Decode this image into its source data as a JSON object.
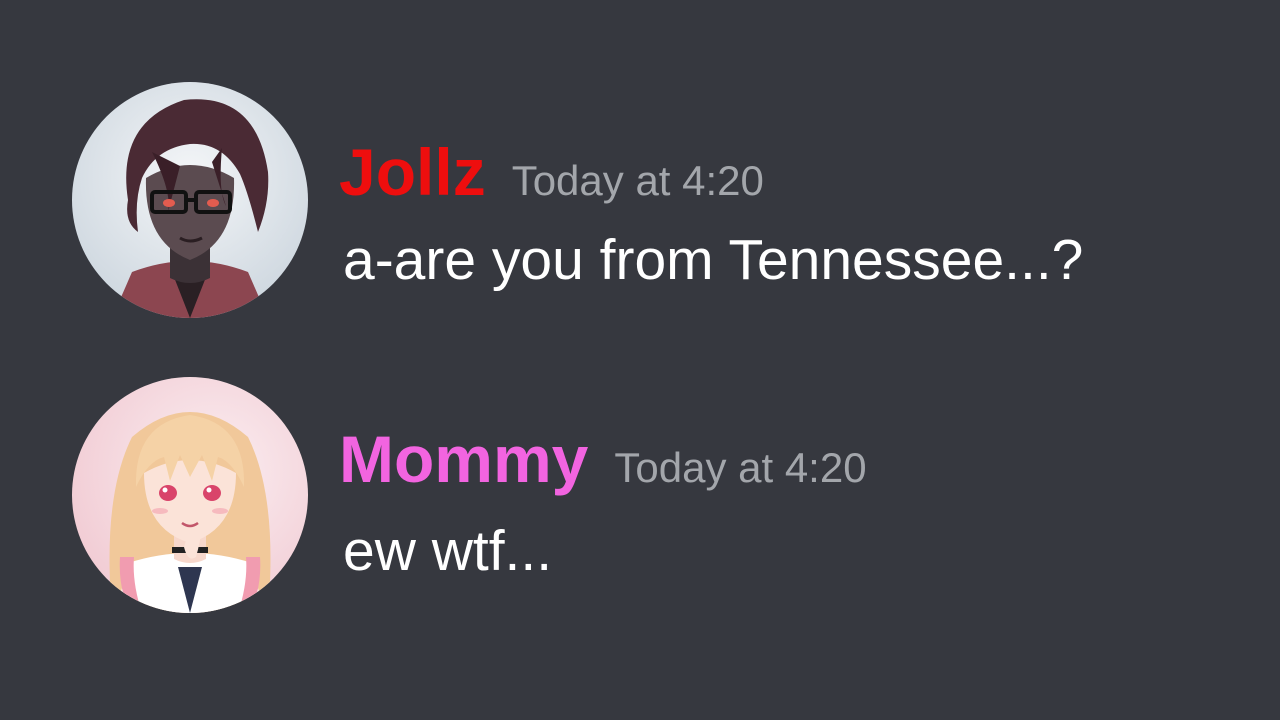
{
  "messages": [
    {
      "username": "Jollz",
      "username_color": "#ee0e0e",
      "timestamp": "Today at 4:20",
      "text": "a-are you from Tennessee...?",
      "avatar_icon": "anime-boy-avatar"
    },
    {
      "username": "Mommy",
      "username_color": "#f264e0",
      "timestamp": "Today at 4:20",
      "text": "ew wtf...",
      "avatar_icon": "anime-girl-avatar"
    }
  ],
  "theme": {
    "background": "#36383f",
    "timestamp_color": "#a3a6ab",
    "text_color": "#ffffff"
  }
}
